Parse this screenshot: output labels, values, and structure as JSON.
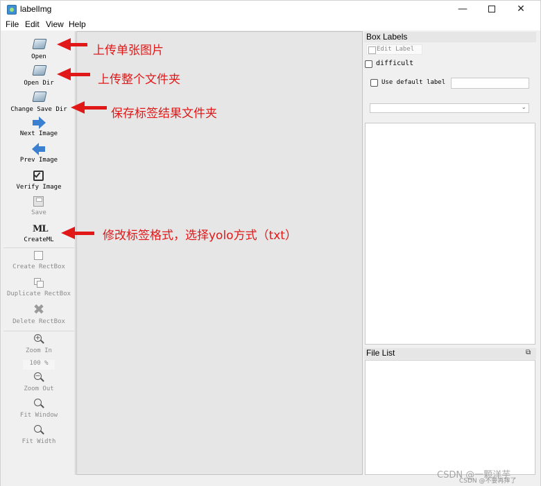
{
  "window": {
    "title": "labelImg"
  },
  "menu": [
    "File",
    "Edit",
    "View",
    "Help"
  ],
  "toolbar": {
    "open": "Open",
    "open_dir": "Open Dir",
    "change_save_dir": "Change Save Dir",
    "next_image": "Next Image",
    "prev_image": "Prev Image",
    "verify_image": "Verify Image",
    "save": "Save",
    "create_ml": "CreateML",
    "create_rectbox": "Create RectBox",
    "duplicate_rectbox": "Duplicate RectBox",
    "delete_rectbox": "Delete RectBox",
    "zoom_in": "Zoom In",
    "zoom_value": "100 %",
    "zoom_out": "Zoom Out",
    "fit_window": "Fit Window",
    "fit_width": "Fit Width"
  },
  "box_labels": {
    "title": "Box Labels",
    "edit_label": "Edit Label",
    "difficult": "difficult",
    "use_default_label": "Use default label",
    "default_label_value": ""
  },
  "file_list": {
    "title": "File List"
  },
  "annotations": {
    "open": "上传单张图片",
    "open_dir": "上传整个文件夹",
    "change_save_dir": "保存标签结果文件夹",
    "create_ml": "修改标签格式，选择yolo方式（txt）"
  },
  "watermark": {
    "main": "CSDN @一颗洋芋",
    "sub": "CSDN @不要再摔了"
  },
  "colors": {
    "annotation_red": "#e01818",
    "canvas_bg": "#e6e6e6",
    "arrow_blue": "#3a7fd0"
  }
}
